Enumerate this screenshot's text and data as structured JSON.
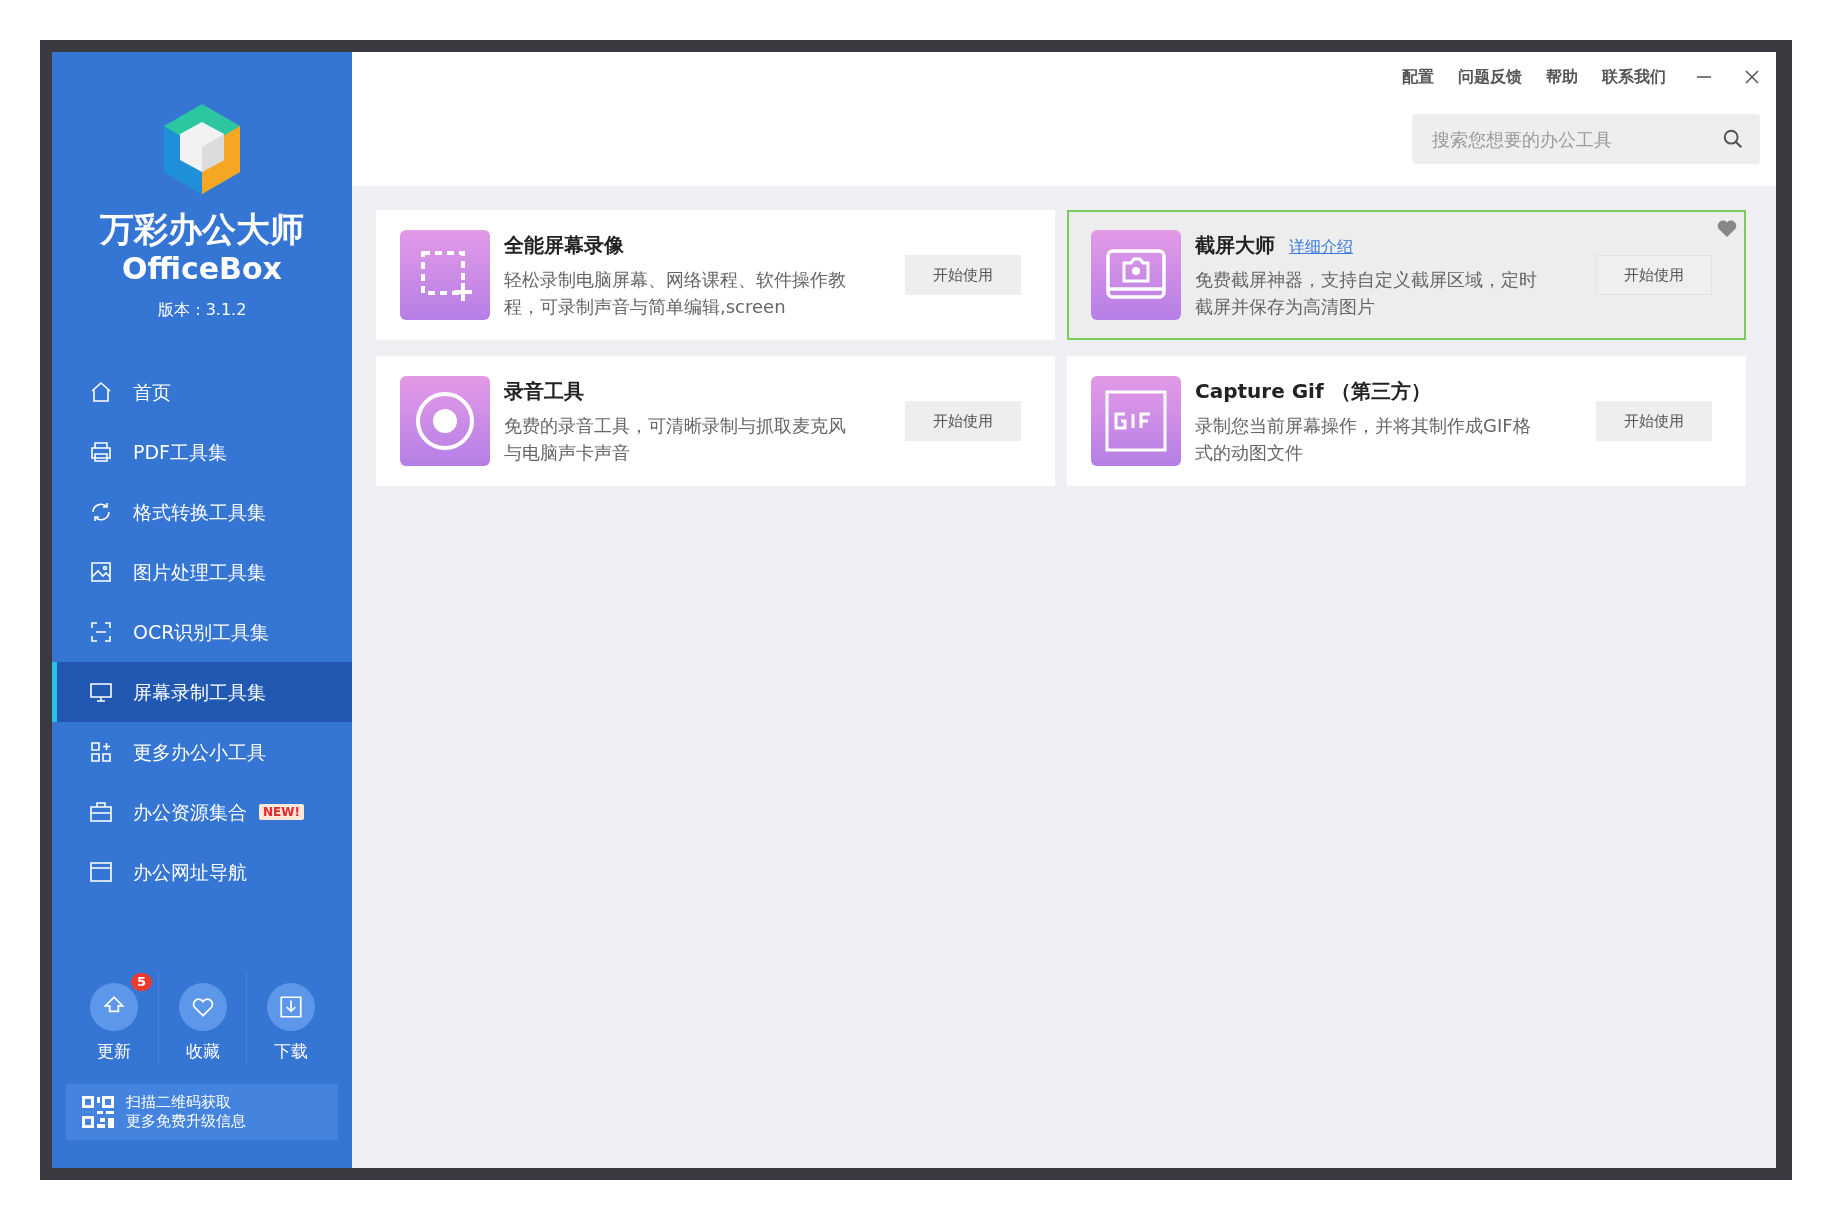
{
  "app": {
    "title": "万彩办公大师",
    "subtitle": "OfficeBox",
    "version": "版本：3.1.2"
  },
  "sidebar": {
    "items": [
      {
        "label": "首页",
        "selected": false
      },
      {
        "label": "PDF工具集",
        "selected": false
      },
      {
        "label": "格式转换工具集",
        "selected": false
      },
      {
        "label": "图片处理工具集",
        "selected": false
      },
      {
        "label": "OCR识别工具集",
        "selected": false
      },
      {
        "label": "屏幕录制工具集",
        "selected": true
      },
      {
        "label": "更多办公小工具",
        "selected": false
      },
      {
        "label": "办公资源集合",
        "selected": false,
        "badge": "NEW!"
      },
      {
        "label": "办公网址导航",
        "selected": false
      }
    ],
    "bottom_buttons": [
      {
        "label": "更新",
        "badge": "5"
      },
      {
        "label": "收藏"
      },
      {
        "label": "下载"
      }
    ],
    "qr_text": [
      "扫描二维码获取",
      "更多免费升级信息"
    ]
  },
  "top_menu": [
    "配置",
    "问题反馈",
    "帮助",
    "联系我们"
  ],
  "search": {
    "placeholder": "搜索您想要的办公工具"
  },
  "tools": [
    {
      "title": "全能屏幕录像",
      "description": "轻松录制电脑屏幕、网络课程、软件操作教程，可录制声音与简单编辑,screen",
      "button": "开始使用",
      "highlighted": false
    },
    {
      "title": "截屏大师",
      "link": "详细介绍",
      "description": "免费截屏神器，支持自定义截屏区域，定时截屏并保存为高清图片",
      "button": "开始使用",
      "highlighted": true
    },
    {
      "title": "录音工具",
      "description": "免费的录音工具，可清晰录制与抓取麦克风与电脑声卡声音",
      "button": "开始使用",
      "highlighted": false
    },
    {
      "title": "Capture Gif （第三方）",
      "description": "录制您当前屏幕操作，并将其制作成GIF格式的动图文件",
      "button": "开始使用",
      "highlighted": false
    }
  ]
}
